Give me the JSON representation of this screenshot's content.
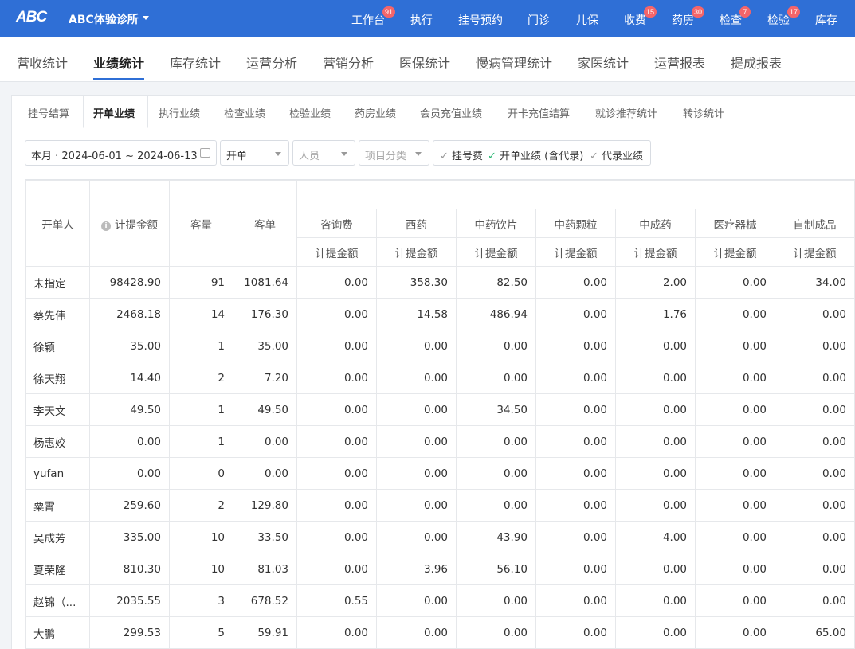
{
  "header": {
    "logo": "ABC",
    "clinic_name": "ABC体验诊所",
    "nav": [
      {
        "label": "工作台",
        "badge": "91"
      },
      {
        "label": "执行",
        "badge": ""
      },
      {
        "label": "挂号预约",
        "badge": ""
      },
      {
        "label": "门诊",
        "badge": ""
      },
      {
        "label": "儿保",
        "badge": ""
      },
      {
        "label": "收费",
        "badge": "15"
      },
      {
        "label": "药房",
        "badge": "30"
      },
      {
        "label": "检查",
        "badge": "7"
      },
      {
        "label": "检验",
        "badge": "17"
      },
      {
        "label": "库存",
        "badge": ""
      }
    ]
  },
  "main_tabs": [
    "营收统计",
    "业绩统计",
    "库存统计",
    "运营分析",
    "营销分析",
    "医保统计",
    "慢病管理统计",
    "家医统计",
    "运营报表",
    "提成报表"
  ],
  "main_tab_active": "业绩统计",
  "sub_tabs": [
    "挂号结算",
    "开单业绩",
    "执行业绩",
    "检查业绩",
    "检验业绩",
    "药房业绩",
    "会员充值业绩",
    "开卡充值结算",
    "就诊推荐统计",
    "转诊统计"
  ],
  "sub_tab_active": "开单业绩",
  "filters": {
    "date_range": "本月 · 2024-06-01 ~ 2024-06-13",
    "type": "开单",
    "person_placeholder": "人员",
    "category_placeholder": "项目分类",
    "check_registration": "挂号费",
    "check_billing": "开单业绩 (含代录)",
    "check_proxy": "代录业绩",
    "check_icon": "✓"
  },
  "table": {
    "headers": {
      "person": "开单人",
      "commission": "计提金额",
      "count": "客量",
      "avg": "客单",
      "sub_header": "计提金额"
    },
    "categories": [
      "咨询费",
      "西药",
      "中药饮片",
      "中药颗粒",
      "中成药",
      "医疗器械",
      "自制成品"
    ],
    "rows": [
      [
        "未指定",
        "98428.90",
        "91",
        "1081.64",
        "0.00",
        "358.30",
        "82.50",
        "0.00",
        "2.00",
        "0.00",
        "34.00"
      ],
      [
        "蔡先伟",
        "2468.18",
        "14",
        "176.30",
        "0.00",
        "14.58",
        "486.94",
        "0.00",
        "1.76",
        "0.00",
        "0.00"
      ],
      [
        "徐颖",
        "35.00",
        "1",
        "35.00",
        "0.00",
        "0.00",
        "0.00",
        "0.00",
        "0.00",
        "0.00",
        "0.00"
      ],
      [
        "徐天翔",
        "14.40",
        "2",
        "7.20",
        "0.00",
        "0.00",
        "0.00",
        "0.00",
        "0.00",
        "0.00",
        "0.00"
      ],
      [
        "李天文",
        "49.50",
        "1",
        "49.50",
        "0.00",
        "0.00",
        "34.50",
        "0.00",
        "0.00",
        "0.00",
        "0.00"
      ],
      [
        "杨惠姣",
        "0.00",
        "1",
        "0.00",
        "0.00",
        "0.00",
        "0.00",
        "0.00",
        "0.00",
        "0.00",
        "0.00"
      ],
      [
        "yufan",
        "0.00",
        "0",
        "0.00",
        "0.00",
        "0.00",
        "0.00",
        "0.00",
        "0.00",
        "0.00",
        "0.00"
      ],
      [
        "粟霄",
        "259.60",
        "2",
        "129.80",
        "0.00",
        "0.00",
        "0.00",
        "0.00",
        "0.00",
        "0.00",
        "0.00"
      ],
      [
        "吴成芳",
        "335.00",
        "10",
        "33.50",
        "0.00",
        "0.00",
        "43.90",
        "0.00",
        "4.00",
        "0.00",
        "0.00"
      ],
      [
        "夏荣隆",
        "810.30",
        "10",
        "81.03",
        "0.00",
        "3.96",
        "56.10",
        "0.00",
        "0.00",
        "0.00",
        "0.00"
      ],
      [
        "赵锦（...",
        "2035.55",
        "3",
        "678.52",
        "0.55",
        "0.00",
        "0.00",
        "0.00",
        "0.00",
        "0.00",
        "0.00"
      ],
      [
        "大鹏",
        "299.53",
        "5",
        "59.91",
        "0.00",
        "0.00",
        "0.00",
        "0.00",
        "0.00",
        "0.00",
        "65.00"
      ]
    ]
  },
  "colors": {
    "primary": "#2f6fd6",
    "badge": "#f4656a",
    "check_on": "#2bb673"
  }
}
